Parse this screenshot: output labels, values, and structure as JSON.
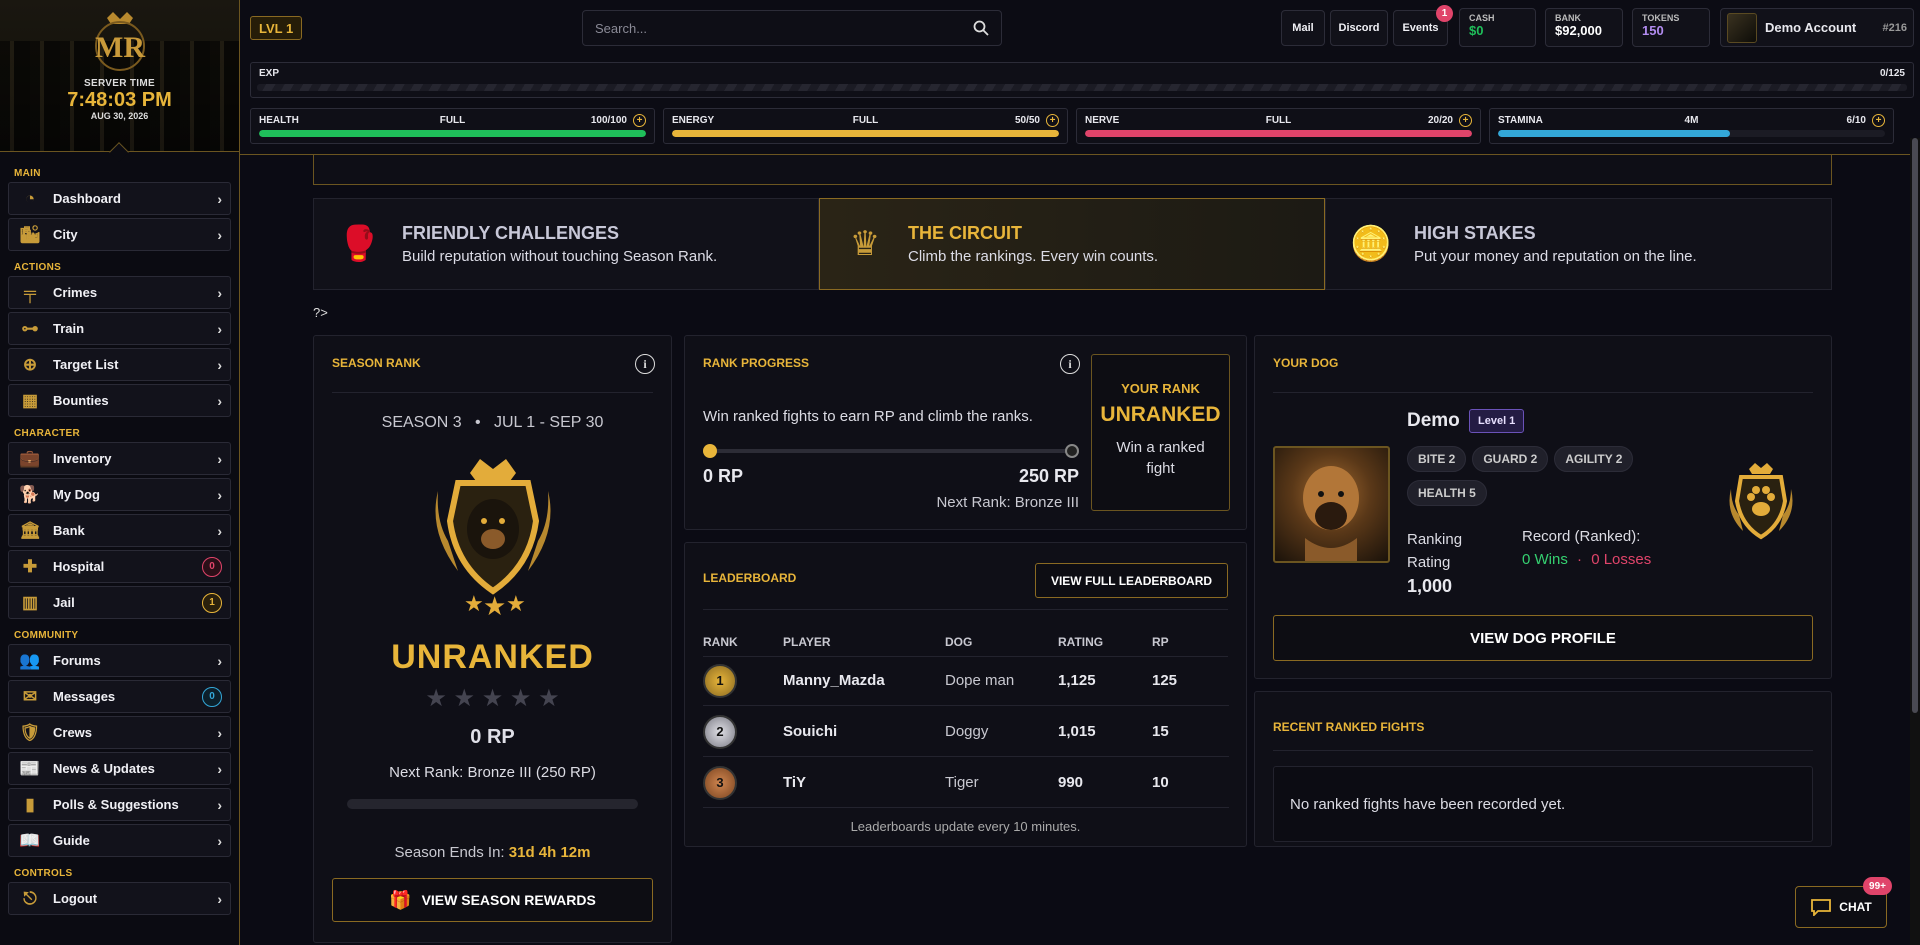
{
  "server": {
    "label": "SERVER TIME",
    "time": "7:48:03 PM",
    "date": "AUG 30, 2026"
  },
  "sidebar": {
    "sections": [
      {
        "title": "MAIN",
        "items": [
          {
            "label": "Dashboard",
            "icon": "speedometer-icon"
          },
          {
            "label": "City",
            "icon": "city-icon"
          }
        ]
      },
      {
        "title": "ACTIONS",
        "items": [
          {
            "label": "Crimes",
            "icon": "gun-icon"
          },
          {
            "label": "Train",
            "icon": "dumbbell-icon"
          },
          {
            "label": "Target List",
            "icon": "crosshair-icon"
          },
          {
            "label": "Bounties",
            "icon": "bounty-icon"
          }
        ]
      },
      {
        "title": "CHARACTER",
        "items": [
          {
            "label": "Inventory",
            "icon": "briefcase-icon"
          },
          {
            "label": "My Dog",
            "icon": "dog-icon"
          },
          {
            "label": "Bank",
            "icon": "bank-icon"
          },
          {
            "label": "Hospital",
            "icon": "medical-cross-icon",
            "badge": "0",
            "badge_color": "red"
          },
          {
            "label": "Jail",
            "icon": "jail-bars-icon",
            "badge": "1",
            "badge_color": "gold"
          }
        ]
      },
      {
        "title": "COMMUNITY",
        "items": [
          {
            "label": "Forums",
            "icon": "users-icon"
          },
          {
            "label": "Messages",
            "icon": "envelope-icon",
            "badge": "0",
            "badge_color": "blue"
          },
          {
            "label": "Crews",
            "icon": "shield-icon"
          },
          {
            "label": "News & Updates",
            "icon": "newspaper-icon"
          },
          {
            "label": "Polls & Suggestions",
            "icon": "bar-chart-icon"
          },
          {
            "label": "Guide",
            "icon": "book-icon"
          }
        ]
      },
      {
        "title": "CONTROLS",
        "items": [
          {
            "label": "Logout",
            "icon": "logout-door-icon"
          }
        ]
      }
    ]
  },
  "topbar": {
    "level": "LVL 1",
    "search_placeholder": "Search...",
    "mail": "Mail",
    "discord": "Discord",
    "events": "Events",
    "events_badge": "1",
    "cash": {
      "label": "CASH",
      "value": "$0"
    },
    "bank": {
      "label": "BANK",
      "value": "$92,000"
    },
    "tokens": {
      "label": "TOKENS",
      "value": "150"
    },
    "account": {
      "name": "Demo Account",
      "id": "#216"
    },
    "exp": {
      "label": "EXP",
      "value": "0/125"
    },
    "bars": [
      {
        "name": "HEALTH",
        "status": "FULL",
        "value": "100/100",
        "pct": 100,
        "color": "#1fbf5a"
      },
      {
        "name": "ENERGY",
        "status": "FULL",
        "value": "50/50",
        "pct": 100,
        "color": "#e8b53a"
      },
      {
        "name": "NERVE",
        "status": "FULL",
        "value": "20/20",
        "pct": 100,
        "color": "#e0446a"
      },
      {
        "name": "STAMINA",
        "status": "4M",
        "value": "6/10",
        "pct": 60,
        "color": "#33a7d8"
      }
    ]
  },
  "modes": [
    {
      "title": "FRIENDLY CHALLENGES",
      "desc": "Build reputation without touching Season Rank.",
      "icon": "boxing-gloves-icon"
    },
    {
      "title": "THE CIRCUIT",
      "desc": "Climb the rankings. Every win counts.",
      "icon": "crown-icon"
    },
    {
      "title": "HIGH STAKES",
      "desc": "Put your money and reputation on the line.",
      "icon": "coins-icon"
    }
  ],
  "php_tag": "?>",
  "season": {
    "title": "SEASON RANK",
    "season": "SEASON 3",
    "dot": "•",
    "range": "JUL 1 - SEP 30",
    "rank": "UNRANKED",
    "stars": "★ ★ ★ ★ ★",
    "rp": "0 RP",
    "next": "Next Rank: Bronze III (250 RP)",
    "ends_label": "Season Ends In:",
    "ends_value": "31d 4h 12m",
    "rewards_btn": "VIEW SEASON REWARDS"
  },
  "progress": {
    "title": "RANK PROGRESS",
    "desc": "Win ranked fights to earn RP and climb the ranks.",
    "min": "0 RP",
    "max": "250 RP",
    "next": "Next Rank: Bronze III",
    "your_rank_label": "YOUR RANK",
    "your_rank": "UNRANKED",
    "hint": "Win a ranked fight"
  },
  "leaderboard": {
    "title": "LEADERBOARD",
    "btn": "VIEW FULL LEADERBOARD",
    "headers": [
      "RANK",
      "PLAYER",
      "DOG",
      "RATING",
      "RP"
    ],
    "rows": [
      {
        "rank": "1",
        "player": "Manny_Mazda",
        "dog": "Dope man",
        "rating": "1,125",
        "rp": "125"
      },
      {
        "rank": "2",
        "player": "Souichi",
        "dog": "Doggy",
        "rating": "1,015",
        "rp": "15"
      },
      {
        "rank": "3",
        "player": "TiY",
        "dog": "Tiger",
        "rating": "990",
        "rp": "10"
      }
    ],
    "note": "Leaderboards update every 10 minutes."
  },
  "dog": {
    "title": "YOUR DOG",
    "name": "Demo",
    "level": "Level 1",
    "tags": [
      "BITE 2",
      "GUARD 2",
      "AGILITY 2",
      "HEALTH 5"
    ],
    "rating_label": "Ranking Rating",
    "rating": "1,000",
    "record_label": "Record (Ranked):",
    "wins": "0 Wins",
    "sep": "·",
    "losses": "0 Losses",
    "btn": "VIEW DOG PROFILE"
  },
  "recent": {
    "title": "RECENT RANKED FIGHTS",
    "empty": "No ranked fights have been recorded yet."
  },
  "chat": {
    "label": "CHAT",
    "badge": "99+"
  }
}
